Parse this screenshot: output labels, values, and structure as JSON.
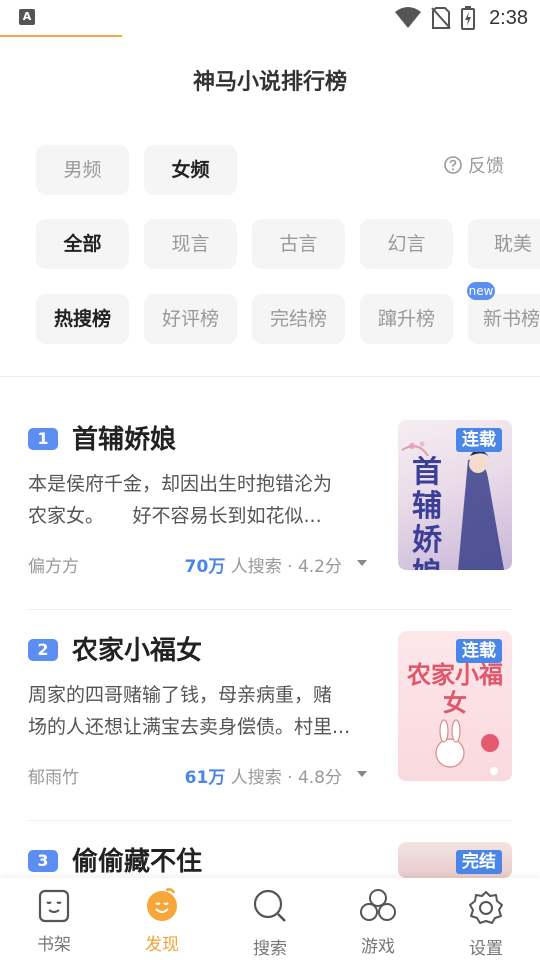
{
  "status_bar": {
    "time": "2:38",
    "left_icon_label": "A"
  },
  "page_title": "神马小说排行榜",
  "gender_tabs": [
    {
      "label": "男频",
      "active": false
    },
    {
      "label": "女频",
      "active": true
    }
  ],
  "feedback": {
    "label": "反馈"
  },
  "category_tabs": [
    {
      "label": "全部",
      "active": true
    },
    {
      "label": "现言",
      "active": false
    },
    {
      "label": "古言",
      "active": false
    },
    {
      "label": "幻言",
      "active": false
    },
    {
      "label": "耽美",
      "active": false
    }
  ],
  "ranking_tabs": [
    {
      "label": "热搜榜",
      "active": true
    },
    {
      "label": "好评榜",
      "active": false
    },
    {
      "label": "完结榜",
      "active": false
    },
    {
      "label": "蹿升榜",
      "active": false
    },
    {
      "label": "新书榜",
      "active": false,
      "badge": "new"
    }
  ],
  "books": [
    {
      "rank": "1",
      "title": "首辅娇娘",
      "desc_line1": "本是侯府千金，却因出生时抱错沦为",
      "desc_line2": "农家女。　　好不容易长到如花似...",
      "author": "偏方方",
      "search_count": "70万",
      "search_suffix": "人搜索 · 4.2分",
      "cover_tag": "连载",
      "cover_text": "首辅娇娘"
    },
    {
      "rank": "2",
      "title": "农家小福女",
      "desc_line1": "周家的四哥赌输了钱，母亲病重，赌",
      "desc_line2": "场的人还想让满宝去卖身偿债。村里...",
      "author": "郁雨竹",
      "search_count": "61万",
      "search_suffix": "人搜索 · 4.8分",
      "cover_tag": "连载",
      "cover_text": "农家小福女"
    },
    {
      "rank": "3",
      "title": "偷偷藏不住",
      "cover_tag": "完结"
    }
  ],
  "bottom_tabs": [
    {
      "label": "书架",
      "icon": "bookshelf-icon",
      "active": false
    },
    {
      "label": "发现",
      "icon": "discover-icon",
      "active": true
    },
    {
      "label": "搜索",
      "icon": "search-icon",
      "active": false
    },
    {
      "label": "游戏",
      "icon": "game-icon",
      "active": false
    },
    {
      "label": "设置",
      "icon": "settings-icon",
      "active": false
    }
  ],
  "colors": {
    "accent": "#f2a33a",
    "blue": "#4a86e8",
    "chip_bg": "#f5f5f5"
  }
}
